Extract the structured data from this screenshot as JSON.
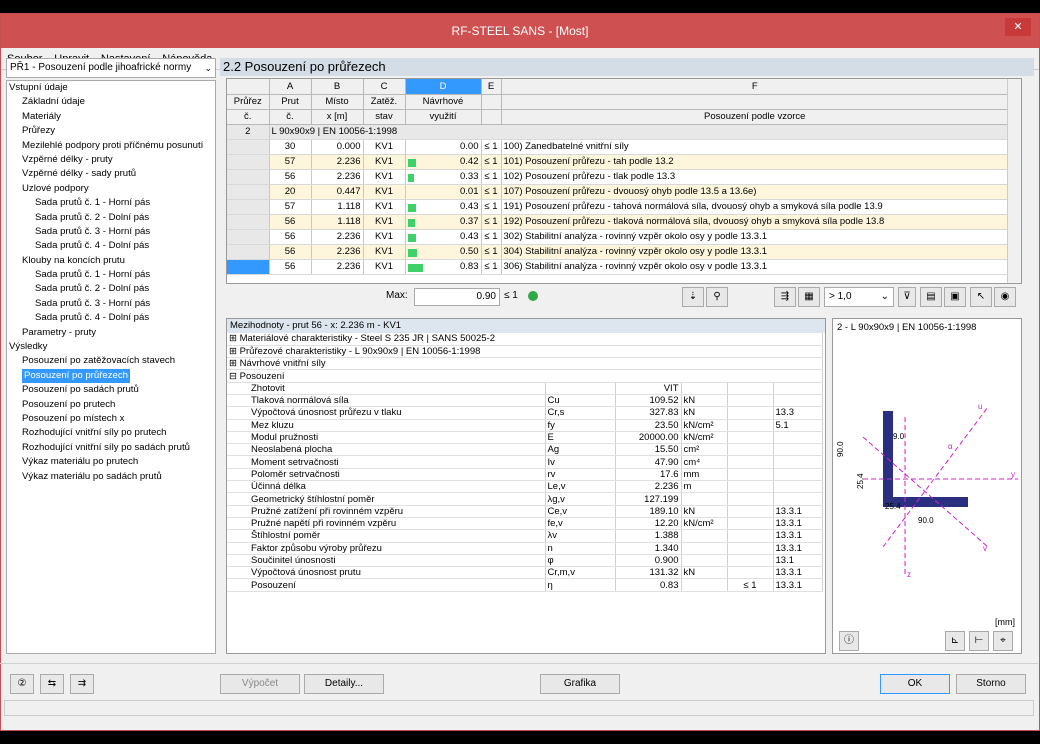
{
  "window": {
    "title": "RF-STEEL SANS - [Most]",
    "close": "✕"
  },
  "menu": [
    "Soubor",
    "Upravit",
    "Nastavení",
    "Nápověda"
  ],
  "case_select": "PŘ1 - Posouzení podle jihoafrické normy",
  "tree": [
    {
      "t": "Vstupní údaje",
      "l": 0
    },
    {
      "t": "Základní údaje",
      "l": 1
    },
    {
      "t": "Materiály",
      "l": 1
    },
    {
      "t": "Průřezy",
      "l": 1
    },
    {
      "t": "Mezilehlé podpory proti příčnému posunutí",
      "l": 1
    },
    {
      "t": "Vzpěrné délky - pruty",
      "l": 1
    },
    {
      "t": "Vzpěrné délky - sady prutů",
      "l": 1
    },
    {
      "t": "Uzlové podpory",
      "l": 1,
      "e": "⊟"
    },
    {
      "t": "Sada prutů č. 1 - Horní pás",
      "l": 2
    },
    {
      "t": "Sada prutů č. 2 - Dolní pás",
      "l": 2
    },
    {
      "t": "Sada prutů č. 3 - Horní pás",
      "l": 2
    },
    {
      "t": "Sada prutů č. 4 - Dolní pás",
      "l": 2
    },
    {
      "t": "Klouby na koncích prutu",
      "l": 1,
      "e": "⊟"
    },
    {
      "t": "Sada prutů č. 1 - Horní pás",
      "l": 2
    },
    {
      "t": "Sada prutů č. 2 - Dolní pás",
      "l": 2
    },
    {
      "t": "Sada prutů č. 3 - Horní pás",
      "l": 2
    },
    {
      "t": "Sada prutů č. 4 - Dolní pás",
      "l": 2
    },
    {
      "t": "Parametry - pruty",
      "l": 1
    },
    {
      "t": "Výsledky",
      "l": 0
    },
    {
      "t": "Posouzení po zatěžovacích stavech",
      "l": 1
    },
    {
      "t": "Posouzení po průřezech",
      "l": 1,
      "sel": true
    },
    {
      "t": "Posouzení po sadách prutů",
      "l": 1
    },
    {
      "t": "Posouzení po prutech",
      "l": 1
    },
    {
      "t": "Posouzení po místech x",
      "l": 1
    },
    {
      "t": "Rozhodující vnitřní síly po prutech",
      "l": 1
    },
    {
      "t": "Rozhodující vnitřní síly po sadách prutů",
      "l": 1
    },
    {
      "t": "Výkaz materiálu po prutech",
      "l": 1
    },
    {
      "t": "Výkaz materiálu po sadách prutů",
      "l": 1
    }
  ],
  "section_title": "2.2 Posouzení po průřezech",
  "grid": {
    "cols": [
      "A",
      "B",
      "C",
      "D",
      "E",
      "F"
    ],
    "h1": [
      "Průřez",
      "Prut",
      "Místo",
      "Zatěž.",
      "Návrhové",
      ""
    ],
    "h2": [
      "č.",
      "č.",
      "x [m]",
      "stav",
      "využití",
      "Posouzení podle vzorce"
    ],
    "group": {
      "no": "2",
      "name": "L 90x90x9 | EN 10056-1:1998"
    },
    "rows": [
      {
        "m": "30",
        "x": "0.000",
        "lc": "KV1",
        "v": "0.00",
        "u": 0.0,
        "s": "≤ 1",
        "f": "100) Zanedbatelné vnitřní síly"
      },
      {
        "m": "57",
        "x": "2.236",
        "lc": "KV1",
        "v": "0.42",
        "u": 0.42,
        "s": "≤ 1",
        "f": "101) Posouzení průřezu - tah podle 13.2"
      },
      {
        "m": "56",
        "x": "2.236",
        "lc": "KV1",
        "v": "0.33",
        "u": 0.33,
        "s": "≤ 1",
        "f": "102) Posouzení průřezu - tlak podle 13.3"
      },
      {
        "m": "20",
        "x": "0.447",
        "lc": "KV1",
        "v": "0.01",
        "u": 0.01,
        "s": "≤ 1",
        "f": "107) Posouzení průřezu - dvouosý ohyb podle 13.5 a 13.6e)"
      },
      {
        "m": "57",
        "x": "1.118",
        "lc": "KV1",
        "v": "0.43",
        "u": 0.43,
        "s": "≤ 1",
        "f": "191) Posouzení průřezu - tahová normálová síla, dvouosý ohyb a smyková síla podle 13.9"
      },
      {
        "m": "56",
        "x": "1.118",
        "lc": "KV1",
        "v": "0.37",
        "u": 0.37,
        "s": "≤ 1",
        "f": "192) Posouzení průřezu - tlaková normálová síla, dvouosý ohyb a smyková síla podle 13.8"
      },
      {
        "m": "56",
        "x": "2.236",
        "lc": "KV1",
        "v": "0.43",
        "u": 0.43,
        "s": "≤ 1",
        "f": "302) Stabilitní analýza - rovinný vzpěr okolo osy y podle 13.3.1"
      },
      {
        "m": "56",
        "x": "2.236",
        "lc": "KV1",
        "v": "0.50",
        "u": 0.5,
        "s": "≤ 1",
        "f": "304) Stabilitní analýza - rovinný vzpěr okolo osy y podle 13.3.1"
      },
      {
        "m": "56",
        "x": "2.236",
        "lc": "KV1",
        "v": "0.83",
        "u": 0.83,
        "s": "≤ 1",
        "f": "306) Stabilitní analýza - rovinný vzpěr okolo osy v podle 13.3.1"
      }
    ],
    "max_label": "Max:",
    "max_value": "0.90",
    "max_sign": "≤ 1"
  },
  "filter_value": "> 1,0",
  "sub_title": "Mezihodnoty - prut 56 - x: 2.236 m - KV1",
  "sub_groups": [
    "Materiálové charakteristiky - Steel S 235 JR | SANS 50025-2",
    "Průřezové charakteristiky - L 90x90x9 | EN 10056-1:1998",
    "Návrhové vnitřní síly",
    "Posouzení"
  ],
  "details": [
    {
      "n": "Zhotovit",
      "s": "",
      "v": "VIT",
      "u": "",
      "r": ""
    },
    {
      "n": "Tlaková normálová síla",
      "s": "Cu",
      "v": "109.52",
      "u": "kN",
      "r": ""
    },
    {
      "n": "Výpočtová únosnost průřezu v tlaku",
      "s": "Cr,s",
      "v": "327.83",
      "u": "kN",
      "r": "13.3"
    },
    {
      "n": "Mez kluzu",
      "s": "fy",
      "v": "23.50",
      "u": "kN/cm²",
      "r": "5.1"
    },
    {
      "n": "Modul pružnosti",
      "s": "E",
      "v": "20000.00",
      "u": "kN/cm²",
      "r": ""
    },
    {
      "n": "Neoslabená plocha",
      "s": "Ag",
      "v": "15.50",
      "u": "cm²",
      "r": ""
    },
    {
      "n": "Moment setrvačnosti",
      "s": "Iv",
      "v": "47.90",
      "u": "cm⁴",
      "r": ""
    },
    {
      "n": "Poloměr setrvačnosti",
      "s": "rv",
      "v": "17.6",
      "u": "mm",
      "r": ""
    },
    {
      "n": "Účinná délka",
      "s": "Le,v",
      "v": "2.236",
      "u": "m",
      "r": ""
    },
    {
      "n": "Geometrický štíhlostní poměr",
      "s": "λg,v",
      "v": "127.199",
      "u": "",
      "r": ""
    },
    {
      "n": "Pružné zatížení při rovinném vzpěru",
      "s": "Ce,v",
      "v": "189.10",
      "u": "kN",
      "r": "13.3.1"
    },
    {
      "n": "Pružné napětí při rovinném vzpěru",
      "s": "fe,v",
      "v": "12.20",
      "u": "kN/cm²",
      "r": "13.3.1"
    },
    {
      "n": "Štíhlostní poměr",
      "s": "λv",
      "v": "1.388",
      "u": "",
      "r": "13.3.1"
    },
    {
      "n": "Faktor způsobu výroby průřezu",
      "s": "n",
      "v": "1.340",
      "u": "",
      "r": "13.3.1"
    },
    {
      "n": "Součinitel únosnosti",
      "s": "φ",
      "v": "0.900",
      "u": "",
      "r": "13.1"
    },
    {
      "n": "Výpočtová únosnost prutu",
      "s": "Cr,m,v",
      "v": "131.32",
      "u": "kN",
      "r": "13.3.1"
    },
    {
      "n": "Posouzení",
      "s": "η",
      "v": "0.83",
      "u": "",
      "c": "≤ 1",
      "r": "13.3.1"
    }
  ],
  "picture": {
    "title": "2 - L 90x90x9 | EN 10056-1:1998",
    "unit": "[mm]",
    "dims": [
      "9.0",
      "90.0",
      "25.4",
      "25.4",
      "90.0"
    ],
    "axes": [
      "u",
      "α",
      "y",
      "z",
      "v"
    ]
  },
  "footer": {
    "calc": "Výpočet",
    "details": "Detaily...",
    "graphics": "Grafika",
    "ok": "OK",
    "cancel": "Storno"
  }
}
